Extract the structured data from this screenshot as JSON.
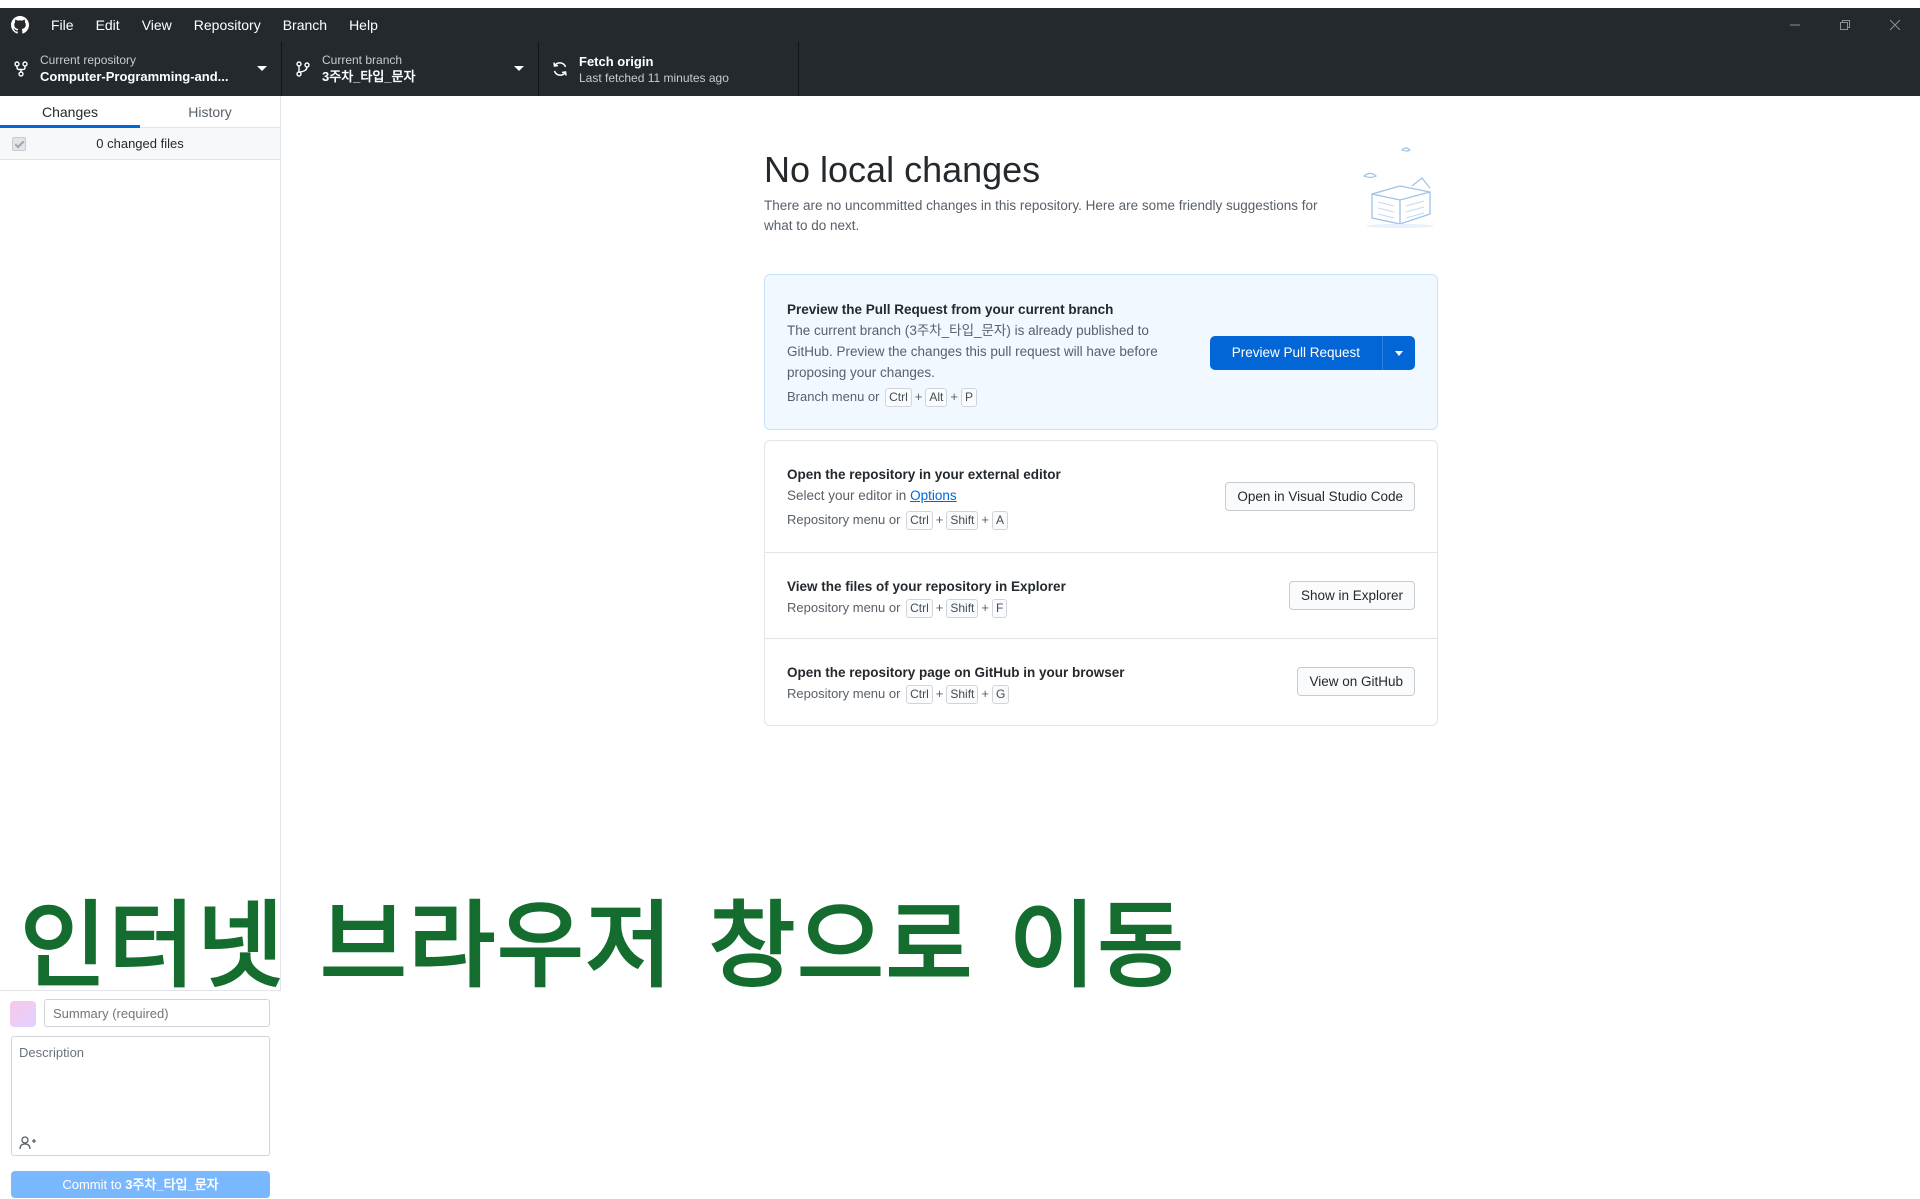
{
  "menu": {
    "items": [
      "File",
      "Edit",
      "View",
      "Repository",
      "Branch",
      "Help"
    ]
  },
  "toolbar": {
    "repo_label": "Current repository",
    "repo_value": "Computer-Programming-and...",
    "branch_label": "Current branch",
    "branch_value": "3주차_타입_문자",
    "fetch_label": "Fetch origin",
    "fetch_value": "Last fetched 11 minutes ago"
  },
  "sidebar": {
    "tabs": [
      "Changes",
      "History"
    ],
    "active_tab": "Changes",
    "changed_files": "0 changed files",
    "commit": {
      "summary_placeholder": "Summary (required)",
      "description_placeholder": "Description",
      "button_prefix": "Commit to ",
      "button_branch": "3주차_타입_문자"
    }
  },
  "main": {
    "title": "No local changes",
    "subtitle": "There are no uncommitted changes in this repository. Here are some friendly suggestions for what to do next.",
    "pull_request": {
      "title": "Preview the Pull Request from your current branch",
      "desc_1": "The current branch (",
      "branch": "3주차_타입_문자",
      "desc_2": ") is already published to GitHub. Preview the changes this pull request will have before proposing your changes.",
      "shortcut_prefix": "Branch menu or",
      "keys": [
        "Ctrl",
        "Alt",
        "P"
      ],
      "button": "Preview Pull Request"
    },
    "editor": {
      "title": "Open the repository in your external editor",
      "desc": "Select your editor in ",
      "link": "Options",
      "shortcut_prefix": "Repository menu or",
      "keys": [
        "Ctrl",
        "Shift",
        "A"
      ],
      "button": "Open in Visual Studio Code"
    },
    "explorer": {
      "title": "View the files of your repository in Explorer",
      "shortcut_prefix": "Repository menu or",
      "keys": [
        "Ctrl",
        "Shift",
        "F"
      ],
      "button": "Show in Explorer"
    },
    "github": {
      "title": "Open the repository page on GitHub in your browser",
      "shortcut_prefix": "Repository menu or",
      "keys": [
        "Ctrl",
        "Shift",
        "G"
      ],
      "button": "View on GitHub"
    }
  },
  "overlay": {
    "caption": "인터넷 브라우저 창으로 이동"
  },
  "colors": {
    "titlebar": "#24292e",
    "primary_blue": "#0366d6",
    "commit_button": "#79b8ff",
    "caption_green": "#146c2e"
  },
  "icons": [
    "github-logo-icon",
    "repo-icon",
    "branch-icon",
    "sync-icon",
    "minimize-icon",
    "restore-icon",
    "close-icon",
    "add-coauthor-icon"
  ]
}
